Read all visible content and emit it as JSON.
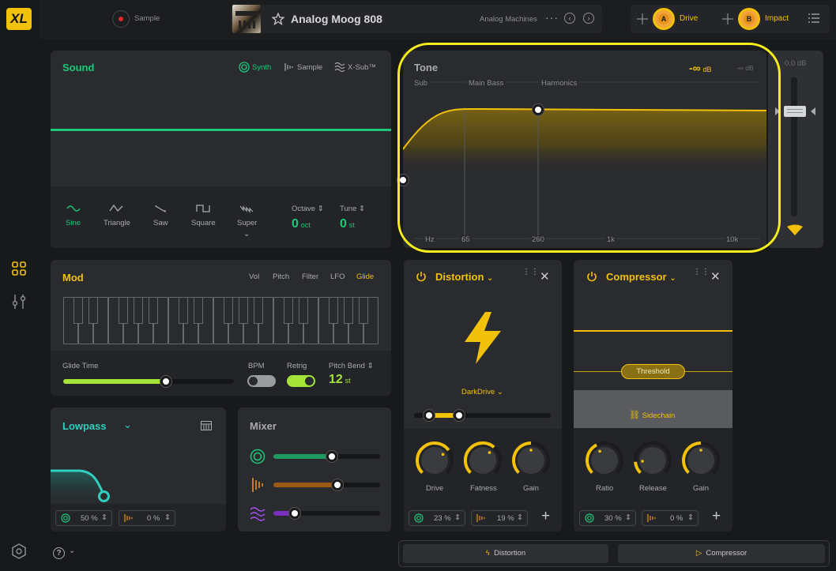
{
  "app": {
    "logo": "XL"
  },
  "header": {
    "record_label": "Sample",
    "preset_name": "Analog Moog 808",
    "preset_category": "Analog Machines",
    "macros": [
      {
        "badge": "A",
        "label": "Drive"
      },
      {
        "badge": "B",
        "label": "Impact"
      }
    ]
  },
  "sound": {
    "title": "Sound",
    "modes": [
      "Synth",
      "Sample",
      "X-Sub™"
    ],
    "active_mode": "Synth",
    "waves": [
      "Sine",
      "Triangle",
      "Saw",
      "Square",
      "Super"
    ],
    "active_wave": "Sine",
    "octave": {
      "label": "Octave",
      "value": "0",
      "unit": "oct"
    },
    "tune": {
      "label": "Tune",
      "value": "0",
      "unit": "st"
    }
  },
  "tone": {
    "title": "Tone",
    "db_value": "-∞",
    "db_unit": "dB",
    "db_secondary": "-∞ dB",
    "bands": [
      "Sub",
      "Main Bass",
      "Harmonics"
    ],
    "freq_ticks": [
      "Hz",
      "65",
      "260",
      "1k",
      "10k"
    ],
    "meter_value": "0.0 dB"
  },
  "mod": {
    "title": "Mod",
    "tabs": [
      "Vol",
      "Pitch",
      "Filter",
      "LFO",
      "Glide"
    ],
    "active_tab": "Glide",
    "glide_time_label": "Glide Time",
    "glide_time": 0.6,
    "bpm_label": "BPM",
    "retrig_label": "Retrig",
    "pitch_bend_label": "Pitch Bend",
    "pitch_bend_value": "12",
    "pitch_bend_unit": "st"
  },
  "filter": {
    "title": "Lowpass",
    "synth_pct": "50 %",
    "sample_pct": "0 %"
  },
  "mixer": {
    "title": "Mixer",
    "levels": [
      0.55,
      0.6,
      0.2
    ]
  },
  "distortion": {
    "title": "Distortion",
    "type": "DarkDrive",
    "knobs": [
      {
        "label": "Drive",
        "value": 0.7
      },
      {
        "label": "Fatness",
        "value": 0.65
      },
      {
        "label": "Gain",
        "value": 0.5
      }
    ],
    "synth_pct": "23 %",
    "sample_pct": "19 %"
  },
  "compressor": {
    "title": "Compressor",
    "threshold_label": "Threshold",
    "sidechain_label": "Sidechain",
    "knobs": [
      {
        "label": "Ratio",
        "value": 0.4
      },
      {
        "label": "Release",
        "value": 0.15
      },
      {
        "label": "Gain",
        "value": 0.5
      }
    ],
    "synth_pct": "30 %",
    "sample_pct": "0 %"
  },
  "chain": [
    "Distortion",
    "Compressor"
  ],
  "colors": {
    "accent": "#f2c10a",
    "synth": "#1ec87a",
    "filter": "#2fd0c0",
    "x_sub": "#a04ff0",
    "sample": "#e8931a"
  }
}
